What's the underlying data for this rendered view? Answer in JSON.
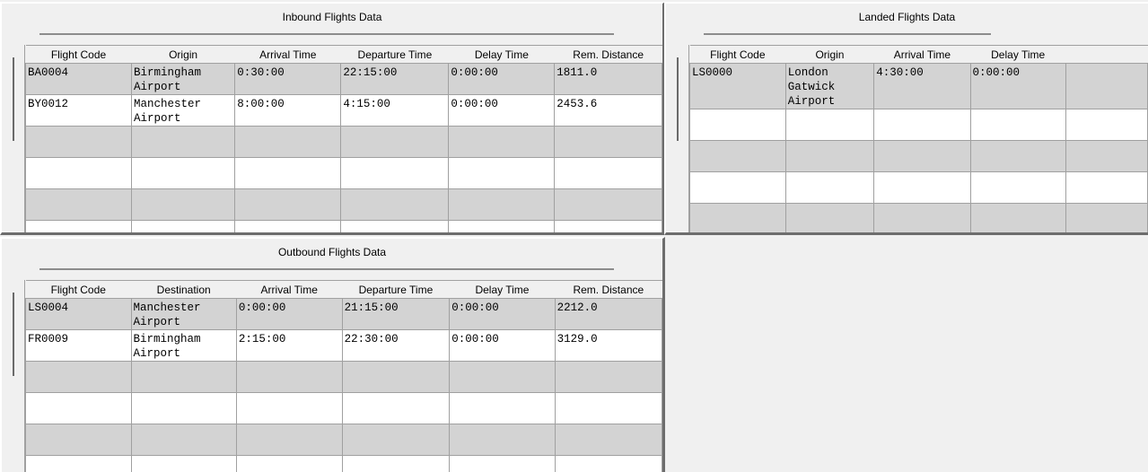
{
  "inbound": {
    "title": "Inbound Flights Data",
    "columns": [
      "Flight Code",
      "Origin",
      "Arrival Time",
      "Departure Time",
      "Delay Time",
      "Rem. Distance"
    ],
    "rows": [
      [
        "BA0004",
        "Birmingham\nAirport",
        "0:30:00",
        "22:15:00",
        "0:00:00",
        "1811.0"
      ],
      [
        "BY0012",
        "Manchester\nAirport",
        "8:00:00",
        "4:15:00",
        "0:00:00",
        "2453.6"
      ],
      [
        "",
        "",
        "",
        "",
        "",
        ""
      ],
      [
        "",
        "",
        "",
        "",
        "",
        ""
      ],
      [
        "",
        "",
        "",
        "",
        "",
        ""
      ],
      [
        "",
        "",
        "",
        "",
        "",
        ""
      ]
    ]
  },
  "landed": {
    "title": "Landed Flights Data",
    "columns": [
      "Flight Code",
      "Origin",
      "Arrival Time",
      "Delay Time",
      ""
    ],
    "rows": [
      [
        "LS0000",
        "London Gatwick\nAirport",
        "4:30:00",
        "0:00:00",
        ""
      ],
      [
        "",
        "",
        "",
        "",
        ""
      ],
      [
        "",
        "",
        "",
        "",
        ""
      ],
      [
        "",
        "",
        "",
        "",
        ""
      ],
      [
        "",
        "",
        "",
        "",
        ""
      ],
      [
        "",
        "",
        "",
        "",
        ""
      ]
    ]
  },
  "outbound": {
    "title": "Outbound Flights Data",
    "columns": [
      "Flight Code",
      "Destination",
      "Arrival Time",
      "Departure Time",
      "Delay Time",
      "Rem. Distance"
    ],
    "rows": [
      [
        "LS0004",
        "Manchester\nAirport",
        "0:00:00",
        "21:15:00",
        "0:00:00",
        "2212.0"
      ],
      [
        "FR0009",
        "Birmingham\nAirport",
        "2:15:00",
        "22:30:00",
        "0:00:00",
        "3129.0"
      ],
      [
        "",
        "",
        "",
        "",
        "",
        ""
      ],
      [
        "",
        "",
        "",
        "",
        "",
        ""
      ],
      [
        "",
        "",
        "",
        "",
        "",
        ""
      ],
      [
        "",
        "",
        "",
        "",
        "",
        ""
      ]
    ]
  },
  "colors": {
    "row_grey": "#d3d3d3",
    "row_white": "#ffffff",
    "window_bg": "#f0f0f0",
    "grid_line": "#a0a0a0"
  }
}
